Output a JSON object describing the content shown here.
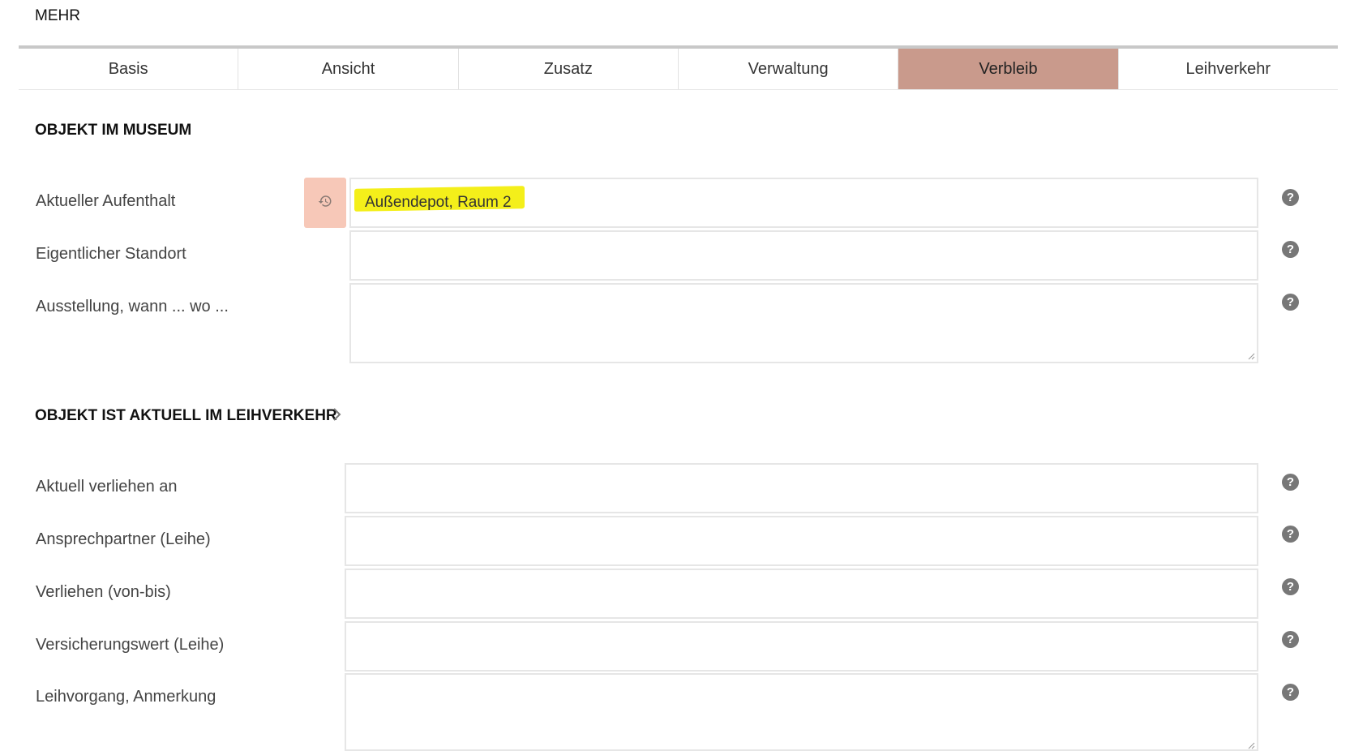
{
  "page": {
    "heading": "MEHR"
  },
  "tabs": [
    {
      "label": "Basis"
    },
    {
      "label": "Ansicht"
    },
    {
      "label": "Zusatz"
    },
    {
      "label": "Verwaltung"
    },
    {
      "label": "Verbleib"
    },
    {
      "label": "Leihverkehr"
    }
  ],
  "active_tab": "Verbleib",
  "colors": {
    "active_tab": "#c99a8c",
    "history_button": "#f7c8b8",
    "highlight": "#f4ef1a"
  },
  "museum": {
    "title": "OBJEKT IM MUSEUM",
    "current_location_label": "Aktueller Aufenthalt",
    "current_location_value": "Außendepot, Raum 2",
    "actual_location_label": "Eigentlicher Standort",
    "actual_location_value": "",
    "exhibition_label": "Ausstellung, wann ... wo ...",
    "exhibition_value": ""
  },
  "loan": {
    "title": "OBJEKT IST AKTUELL IM LEIHVERKEHR",
    "lent_to_label": "Aktuell verliehen an",
    "contact_label": "Ansprechpartner (Leihe)",
    "period_label": "Verliehen (von-bis)",
    "insurance_label": "Versicherungswert (Leihe)",
    "note_label": "Leihvorgang, Anmerkung"
  },
  "icons": {
    "help": "?",
    "history": "history-icon",
    "chevron": "chevron-right-icon"
  }
}
